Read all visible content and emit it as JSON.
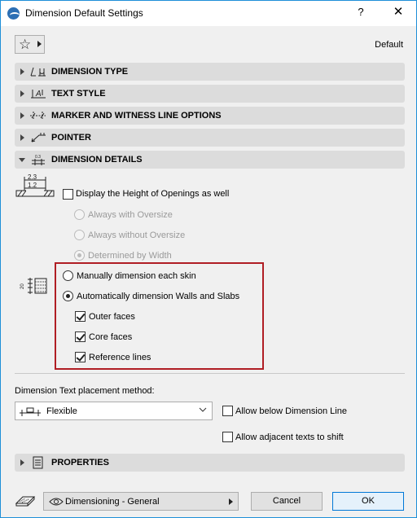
{
  "window": {
    "title": "Dimension Default Settings",
    "help_label": "?",
    "close_label": "✕"
  },
  "toolbar": {
    "favorites_icon": "star-icon",
    "default_label": "Default"
  },
  "sections": [
    {
      "label": "DIMENSION TYPE",
      "expanded": false
    },
    {
      "label": "TEXT STYLE",
      "expanded": false
    },
    {
      "label": "MARKER AND WITNESS LINE OPTIONS",
      "expanded": false
    },
    {
      "label": "POINTER",
      "expanded": false
    },
    {
      "label": "DIMENSION DETAILS",
      "expanded": true
    }
  ],
  "dimension_details": {
    "openings_icon_top": "2.3",
    "openings_icon_bottom": "1.2",
    "display_height_label": "Display the Height of Openings as well",
    "display_height_checked": false,
    "height_options": [
      {
        "label": "Always with Oversize",
        "selected": false,
        "disabled": true
      },
      {
        "label": "Always without Oversize",
        "selected": false,
        "disabled": true
      },
      {
        "label": "Determined by Width",
        "selected": true,
        "disabled": true
      }
    ],
    "skin_options": [
      {
        "label": "Manually dimension each skin",
        "selected": false
      },
      {
        "label": "Automatically dimension Walls and Slabs",
        "selected": true
      }
    ],
    "auto_checks": [
      {
        "label": "Outer faces",
        "checked": true
      },
      {
        "label": "Core faces",
        "checked": true
      },
      {
        "label": "Reference lines",
        "checked": true
      }
    ]
  },
  "text_placement": {
    "label": "Dimension Text placement method:",
    "selected": "Flexible",
    "allow_below_label": "Allow below Dimension Line",
    "allow_below_checked": false,
    "allow_adjacent_label": "Allow adjacent texts to shift",
    "allow_adjacent_checked": false
  },
  "properties_section": {
    "label": "PROPERTIES",
    "expanded": false
  },
  "footer": {
    "profile_label": "Dimensioning - General",
    "cancel_label": "Cancel",
    "ok_label": "OK"
  },
  "colors": {
    "highlight_border": "#b01e24",
    "window_border": "#1e8fd8",
    "ok_border": "#0078d7"
  }
}
